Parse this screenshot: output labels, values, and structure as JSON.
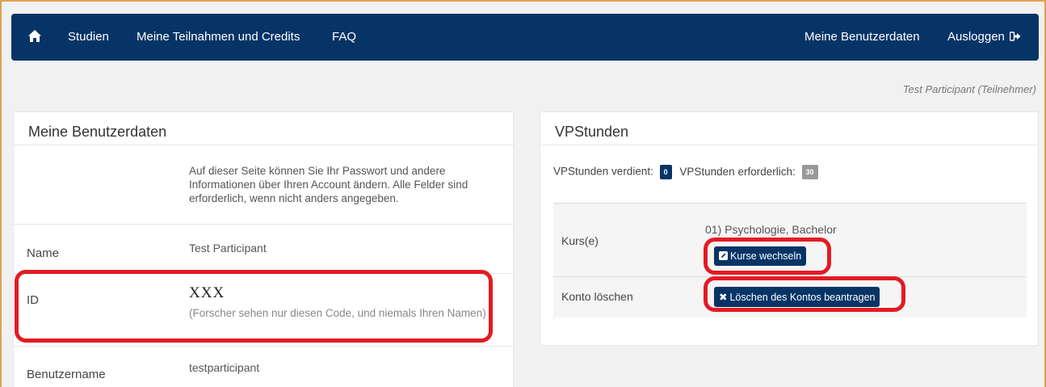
{
  "nav": {
    "home_icon": "home-icon",
    "studien": "Studien",
    "teilnahmen": "Meine Teilnahmen und Credits",
    "faq": "FAQ",
    "benutzerdaten": "Meine Benutzerdaten",
    "ausloggen": "Ausloggen",
    "logout_icon": "sign-out-icon"
  },
  "role_text": "Test Participant (Teilnehmer)",
  "user_panel": {
    "title": "Meine Benutzerdaten",
    "info": "Auf dieser Seite können Sie Ihr Passwort und andere Informationen über Ihren Account ändern. Alle Felder sind erforderlich, wenn nicht anders angegeben.",
    "name_label": "Name",
    "name_value": "Test Participant",
    "id_label": "ID",
    "id_value": "XXX",
    "id_hint": "(Forscher sehen nur diesen Code, und niemals Ihren Namen)",
    "username_label": "Benutzername",
    "username_value": "testparticipant"
  },
  "vp_panel": {
    "title": "VPStunden",
    "earned_label": "VPStunden verdient:",
    "earned_value": "0",
    "required_label": "VPStunden erforderlich:",
    "required_value": "30",
    "course_label": "Kurs(e)",
    "course_value": "01) Psychologie, Bachelor",
    "change_course_button": "Kurse wechseln",
    "delete_label": "Konto löschen",
    "delete_button": "Löschen des Kontos beantragen"
  },
  "colors": {
    "navbar": "#063466",
    "highlight": "#e31b23",
    "badge_earned": "#063466",
    "badge_required": "#999999"
  }
}
